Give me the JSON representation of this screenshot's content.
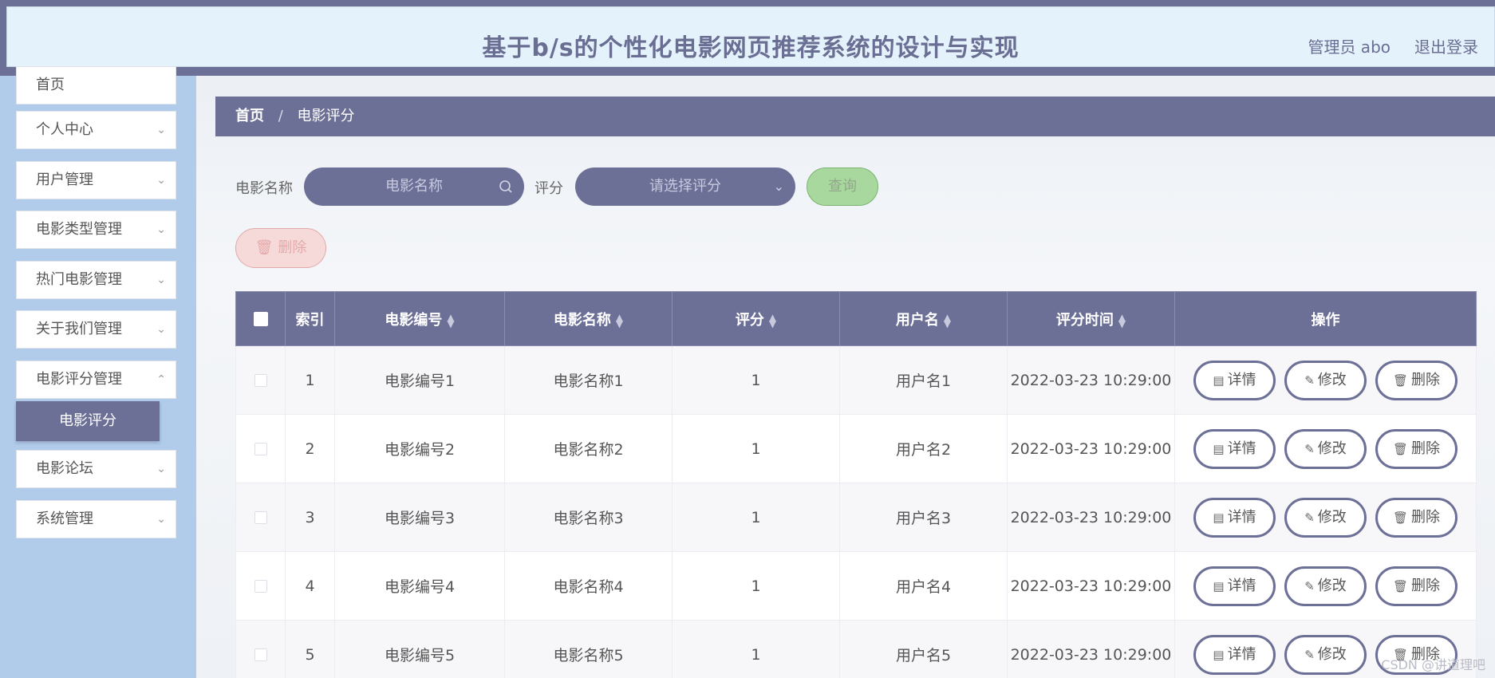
{
  "header": {
    "title": "基于b/s的个性化电影网页推荐系统的设计与实现",
    "user_label": "管理员 abo",
    "logout_label": "退出登录"
  },
  "sidebar": {
    "items": [
      {
        "label": "首页"
      },
      {
        "label": "个人中心"
      },
      {
        "label": "用户管理"
      },
      {
        "label": "电影类型管理"
      },
      {
        "label": "热门电影管理"
      },
      {
        "label": "关于我们管理"
      },
      {
        "label": "电影评分管理"
      },
      {
        "label": "电影论坛"
      },
      {
        "label": "系统管理"
      }
    ],
    "active_sub": "电影评分",
    "chevron": "chevron-down-icon"
  },
  "breadcrumb": {
    "home": "首页",
    "separator": "/",
    "current": "电影评分"
  },
  "search": {
    "name_label": "电影名称",
    "name_placeholder": "电影名称",
    "score_label": "评分",
    "score_placeholder": "请选择评分",
    "query_label": "查询",
    "delete_label": "删除"
  },
  "table": {
    "columns": [
      "索引",
      "电影编号",
      "电影名称",
      "评分",
      "用户名",
      "评分时间",
      "操作"
    ],
    "rows": [
      {
        "index": "1",
        "code": "电影编号1",
        "name": "电影名称1",
        "score": "1",
        "user": "用户名1",
        "time": "2022-03-23 10:29:00"
      },
      {
        "index": "2",
        "code": "电影编号2",
        "name": "电影名称2",
        "score": "1",
        "user": "用户名2",
        "time": "2022-03-23 10:29:00"
      },
      {
        "index": "3",
        "code": "电影编号3",
        "name": "电影名称3",
        "score": "1",
        "user": "用户名3",
        "time": "2022-03-23 10:29:00"
      },
      {
        "index": "4",
        "code": "电影编号4",
        "name": "电影名称4",
        "score": "1",
        "user": "用户名4",
        "time": "2022-03-23 10:29:00"
      },
      {
        "index": "5",
        "code": "电影编号5",
        "name": "电影名称5",
        "score": "1",
        "user": "用户名5",
        "time": "2022-03-23 10:29:00"
      }
    ],
    "actions": {
      "detail": "详情",
      "edit": "修改",
      "delete": "删除"
    }
  },
  "watermark": "CSDN @讲道理吧",
  "colors": {
    "primary": "#6c6f96",
    "sidebar": "#b1cbeb",
    "query": "#a9d89f",
    "danger": "#f6d9d9"
  }
}
